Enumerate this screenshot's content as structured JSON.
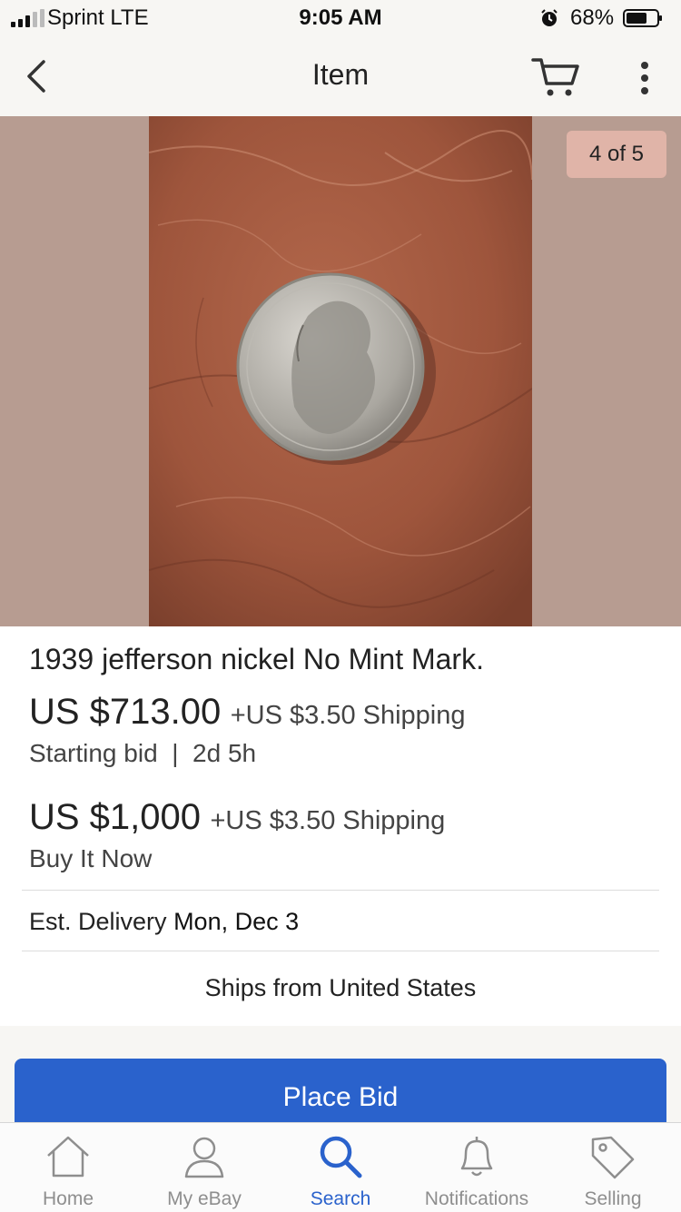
{
  "status_bar": {
    "carrier": "Sprint  LTE",
    "time": "9:05 AM",
    "battery": "68%",
    "battery_level": 0.68
  },
  "nav": {
    "title": "Item",
    "back_icon": "chevron-left-icon",
    "cart_icon": "cart-icon",
    "more_icon": "more-vertical-icon"
  },
  "gallery": {
    "counter": "4 of 5",
    "background": "#b79c91"
  },
  "item": {
    "title": "1939 jefferson nickel No Mint Mark.",
    "auction": {
      "price": "US $713.00",
      "shipping": "+US $3.50 Shipping",
      "status": "Starting bid  |  2d 5h"
    },
    "buy_now": {
      "price": "US $1,000",
      "shipping": "+US $3.50 Shipping",
      "label": "Buy It Now"
    },
    "delivery_prefix": "Est. Delivery",
    "delivery_date": "Mon, Dec 3",
    "ships_from": "Ships from United States"
  },
  "actions": {
    "place_bid": "Place Bid",
    "accent": "#2a62cc"
  },
  "tabs": [
    {
      "label": "Home",
      "icon": "home-icon",
      "active": false
    },
    {
      "label": "My eBay",
      "icon": "user-icon",
      "active": false
    },
    {
      "label": "Search",
      "icon": "search-icon",
      "active": true
    },
    {
      "label": "Notifications",
      "icon": "bell-icon",
      "active": false
    },
    {
      "label": "Selling",
      "icon": "tag-icon",
      "active": false
    }
  ]
}
